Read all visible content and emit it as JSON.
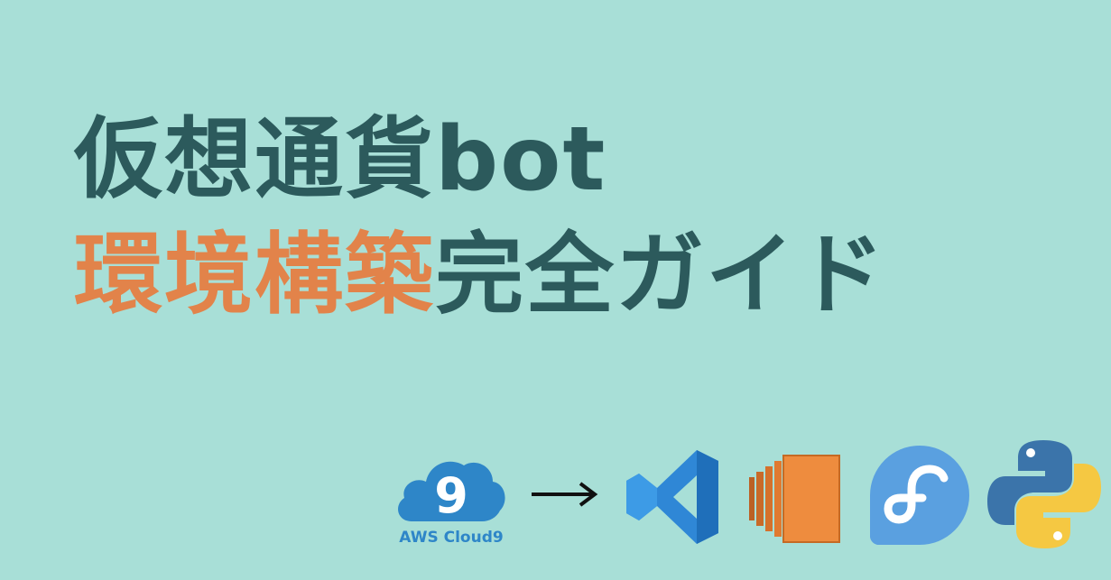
{
  "title": {
    "line1": "仮想通貨bot",
    "line2_accent": "環境構築",
    "line2_rest": "完全ガイド"
  },
  "logos": {
    "cloud9_mark": "9",
    "cloud9_label": "AWS Cloud9",
    "arrow": "→"
  },
  "colors": {
    "background": "#a8dfd7",
    "title_dark": "#2c5a5c",
    "title_accent": "#e2834a",
    "cloud9_blue": "#2e86c8",
    "vscode_blue": "#2f87d6",
    "ec2_orange": "#e8823a",
    "fedora_blue": "#5aa0e0",
    "python_blue": "#3b74aa",
    "python_yellow": "#f5c842"
  },
  "icons": [
    "aws-cloud9-icon",
    "arrow-right-icon",
    "vscode-icon",
    "aws-ec2-icon",
    "fedora-icon",
    "python-icon"
  ]
}
